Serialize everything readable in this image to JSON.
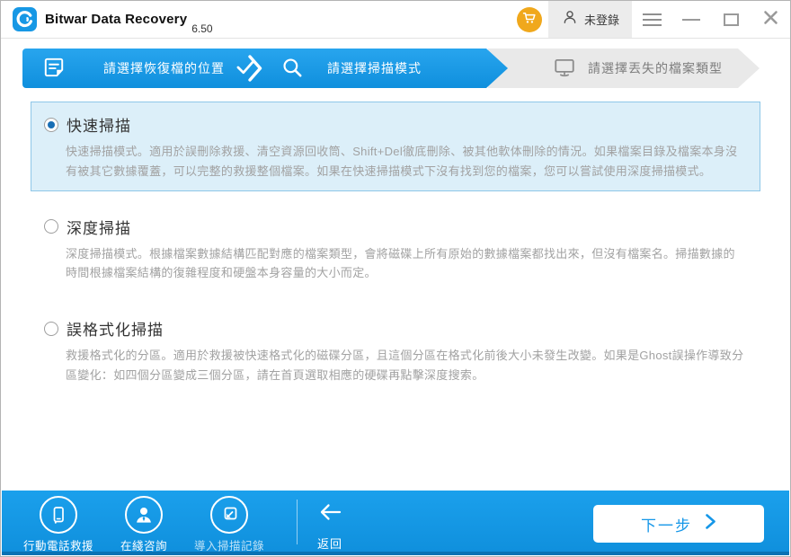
{
  "window": {
    "title": "Bitwar Data Recovery",
    "version": "6.50",
    "login_label": "未登錄"
  },
  "colors": {
    "primary_blue": "#1697e8",
    "footer_bottom_strip": "#0a72b4",
    "cart_orange": "#f0a81c",
    "selected_option_bg": "#dceff9",
    "selected_option_border": "#8fc7e8",
    "inactive_step_bg": "#e9e9e9"
  },
  "wizard": {
    "steps": [
      {
        "label": "請選擇恢復檔的位置",
        "state": "done",
        "icon": "document-icon"
      },
      {
        "label": "請選擇掃描模式",
        "state": "active",
        "icon": "search-icon"
      },
      {
        "label": "請選擇丟失的檔案類型",
        "state": "pending",
        "icon": "monitor-icon"
      }
    ]
  },
  "scan_modes": [
    {
      "title": "快速掃描",
      "selected": true,
      "description": "快速掃描模式。適用於誤刪除救援、清空資源回收筒、Shift+Del徹底刪除、被其他軟体刪除的情況。如果檔案目錄及檔案本身沒有被其它數據覆蓋，可以完整的救援整個檔案。如果在快速掃描模式下沒有找到您的檔案，您可以嘗試使用深度掃描模式。"
    },
    {
      "title": "深度掃描",
      "selected": false,
      "description": "深度掃描模式。根據檔案數據結構匹配對應的檔案類型，會將磁碟上所有原始的數據檔案都找出來，但沒有檔案名。掃描數據的時間根據檔案結構的復雜程度和硬盤本身容量的大小而定。"
    },
    {
      "title": "誤格式化掃描",
      "selected": false,
      "description": "救援格式化的分區。適用於救援被快速格式化的磁碟分區，且這個分區在格式化前後大小未發生改變。如果是Ghost誤操作導致分區變化：如四個分區變成三個分區，請在首頁選取相應的硬碟再點擊深度搜索。"
    }
  ],
  "footer": {
    "tools": [
      {
        "label": "行動電話救援",
        "icon": "phone-icon"
      },
      {
        "label": "在綫咨詢",
        "icon": "support-person-icon"
      },
      {
        "label": "導入掃描記錄",
        "icon": "import-icon"
      }
    ],
    "back_label": "返回",
    "next_label": "下一步"
  }
}
